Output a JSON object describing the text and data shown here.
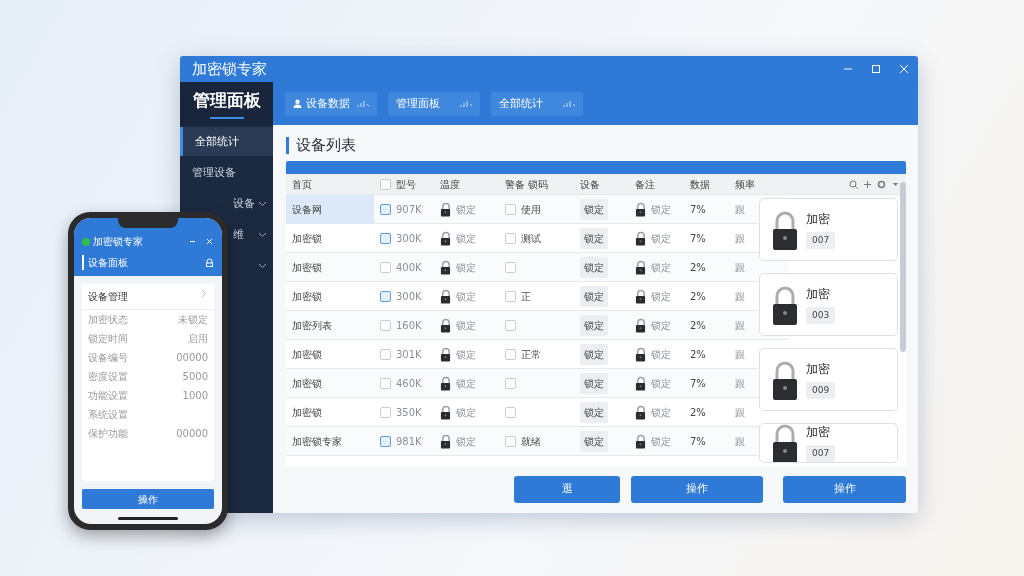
{
  "window": {
    "title": "加密锁专家"
  },
  "sidebar": {
    "title": "管理面板",
    "items": [
      {
        "label": "全部统计",
        "selected": true,
        "expandable": false
      },
      {
        "label": "管理设备",
        "selected": false,
        "expandable": false
      },
      {
        "label": "设备",
        "selected": false,
        "expandable": true
      },
      {
        "label": "维",
        "selected": false,
        "expandable": true
      },
      {
        "selected": false,
        "expandable": true
      }
    ]
  },
  "toolbar": [
    {
      "label": "设备数据",
      "kind": "user"
    },
    {
      "label": "管理面板",
      "kind": "plain"
    },
    {
      "label": "全部统计",
      "kind": "plain"
    }
  ],
  "heading": "设备列表",
  "table": {
    "select_all": false,
    "columns": [
      "首页",
      "型号",
      "温度",
      "警备 锁码",
      "设备",
      "备注",
      "数据",
      "频率"
    ],
    "rows": [
      {
        "name": "设备网",
        "selected": true,
        "checked": true,
        "model": "907K",
        "lock": "锁定",
        "flag": false,
        "note": "使用",
        "device": "锁定",
        "status": "锁定",
        "rate": "7%",
        "freq": "跟"
      },
      {
        "name": "加密锁",
        "selected": false,
        "checked": true,
        "model": "300K",
        "lock": "锁定",
        "flag": false,
        "note": "测试",
        "device": "锁定",
        "status": "锁定",
        "rate": "7%",
        "freq": "跟"
      },
      {
        "name": "加密锁",
        "selected": false,
        "checked": false,
        "model": "400K",
        "lock": "锁定",
        "flag": false,
        "device": "锁定",
        "status": "锁定",
        "rate": "2%",
        "freq": "跟"
      },
      {
        "name": "加密锁",
        "selected": false,
        "checked": true,
        "model": "300K",
        "lock": "锁定",
        "flag": false,
        "note": "正",
        "device": "锁定",
        "status": "锁定",
        "rate": "2%",
        "freq": "跟"
      },
      {
        "name": "加密列表",
        "selected": false,
        "checked": false,
        "model": "160K",
        "lock": "锁定",
        "flag": false,
        "device": "锁定",
        "status": "锁定",
        "rate": "2%",
        "freq": "跟"
      },
      {
        "name": "加密锁",
        "selected": false,
        "checked": false,
        "model": "301K",
        "lock": "锁定",
        "flag": false,
        "note": "正常",
        "device": "锁定",
        "status": "锁定",
        "rate": "2%",
        "freq": "跟"
      },
      {
        "name": "加密锁",
        "selected": false,
        "checked": false,
        "model": "460K",
        "lock": "锁定",
        "flag": false,
        "device": "锁定",
        "status": "锁定",
        "rate": "7%",
        "freq": "跟"
      },
      {
        "name": "加密锁",
        "selected": false,
        "checked": false,
        "model": "350K",
        "lock": "锁定",
        "flag": false,
        "device": "锁定",
        "status": "锁定",
        "rate": "2%",
        "freq": "跟"
      },
      {
        "name": "加密锁专家",
        "selected": false,
        "checked": true,
        "model": "981K",
        "lock": "锁定",
        "flag": false,
        "note": "就绪",
        "device": "锁定",
        "status": "锁定",
        "rate": "7%",
        "freq": "跟"
      }
    ]
  },
  "lock_cards": [
    {
      "title": "加密",
      "code": "007"
    },
    {
      "title": "加密",
      "code": "003"
    },
    {
      "title": "加密",
      "code": "009"
    },
    {
      "title": "加密",
      "code": "007"
    }
  ],
  "buttons": [
    "逛",
    "操作",
    "操作"
  ],
  "phone": {
    "title": "加密锁专家",
    "subtitle": "设备面板",
    "section": "设备管理",
    "rows": [
      {
        "label": "加密状态",
        "value": "未锁定"
      },
      {
        "label": "锁定时间",
        "value": "启用"
      },
      {
        "label": "设备编号",
        "value": "00000"
      },
      {
        "label": "密度设置",
        "value": "5000"
      },
      {
        "label": "功能设置",
        "value": "1000"
      },
      {
        "label": "系统设置"
      },
      {
        "label": "保护功能",
        "value": "00000"
      }
    ],
    "button": "操作"
  }
}
